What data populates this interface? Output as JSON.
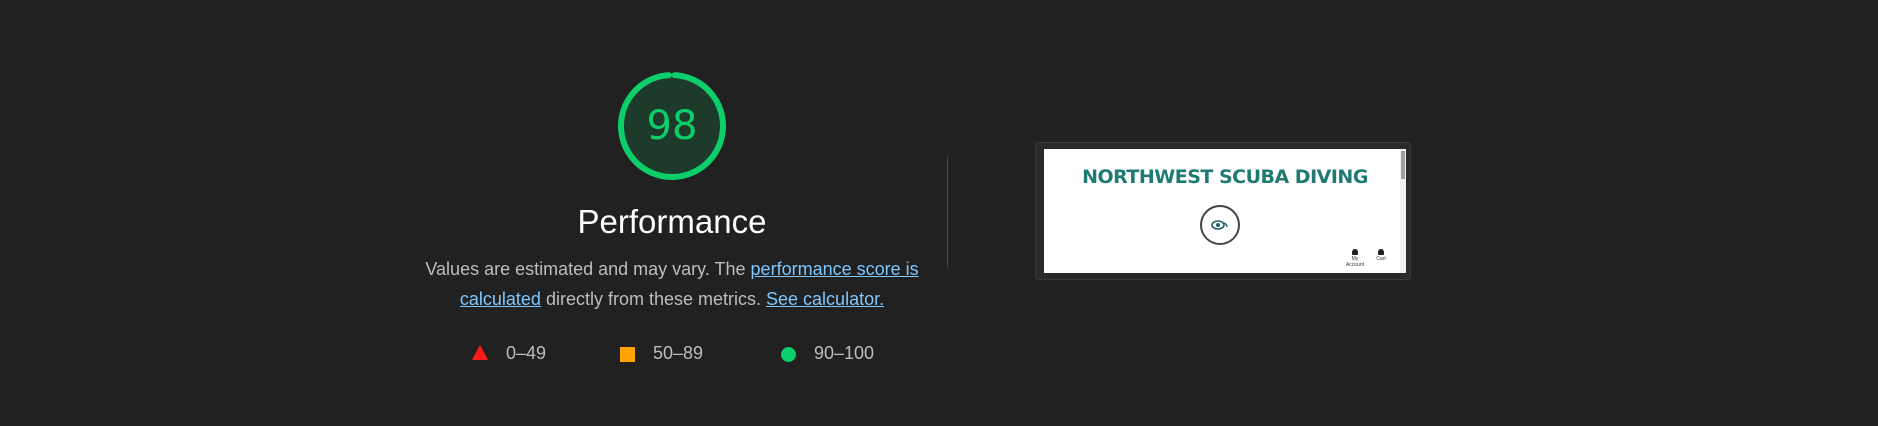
{
  "score": {
    "value": "98",
    "fraction": 0.98,
    "color": "#0cce6b"
  },
  "category": {
    "title": "Performance"
  },
  "description": {
    "prefix": "Values are estimated and may vary. The ",
    "link_score": "performance score is calculated",
    "middle": " directly from these metrics. ",
    "link_calculator": "See calculator."
  },
  "legend": [
    {
      "range": "0–49",
      "icon": "triangle-icon",
      "color": "#ff1a1a"
    },
    {
      "range": "50–89",
      "icon": "square-icon",
      "color": "#ffa400"
    },
    {
      "range": "90–100",
      "icon": "circle-icon",
      "color": "#0cce6b"
    }
  ],
  "screenshot": {
    "site_title": "NORTHWEST SCUBA DIVING",
    "nav": [
      "My Account",
      "Cart"
    ]
  }
}
